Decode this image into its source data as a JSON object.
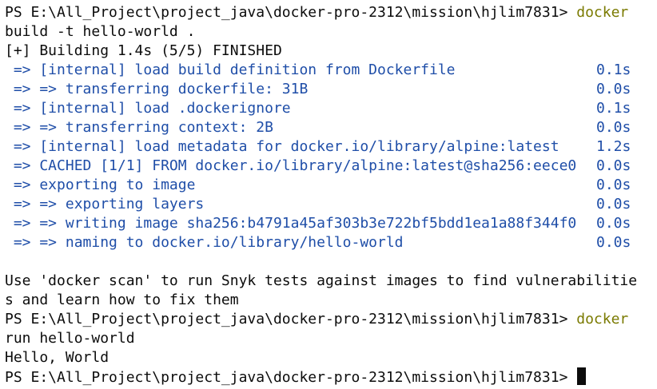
{
  "prompt": "PS E:\\All_Project\\project_java\\docker-pro-2312\\mission\\hjlim7831> ",
  "cmd1": {
    "first": "docker",
    "second": "build -t hello-world ."
  },
  "build_status": "[+] Building 1.4s (5/5) FINISHED",
  "build_steps": [
    {
      "desc": " => [internal] load build definition from Dockerfile",
      "time": "0.1s"
    },
    {
      "desc": " => => transferring dockerfile: 31B",
      "time": "0.0s"
    },
    {
      "desc": " => [internal] load .dockerignore",
      "time": "0.1s"
    },
    {
      "desc": " => => transferring context: 2B",
      "time": "0.0s"
    },
    {
      "desc": " => [internal] load metadata for docker.io/library/alpine:latest",
      "time": "1.2s"
    },
    {
      "desc": " => CACHED [1/1] FROM docker.io/library/alpine:latest@sha256:eece0",
      "time": "0.0s"
    },
    {
      "desc": " => exporting to image",
      "time": "0.0s"
    },
    {
      "desc": " => => exporting layers",
      "time": "0.0s"
    },
    {
      "desc": " => => writing image sha256:b4791a45af303b3e722bf5bdd1ea1a88f344f0",
      "time": "0.0s"
    },
    {
      "desc": " => => naming to docker.io/library/hello-world",
      "time": "0.0s"
    }
  ],
  "scan_hint": {
    "line1": "Use 'docker scan' to run Snyk tests against images to find vulnerabilitie",
    "line2": "s and learn how to fix them"
  },
  "cmd2": {
    "first": "docker",
    "second": "run hello-world"
  },
  "output": "Hello, World",
  "colors": {
    "background": "#ffffff",
    "text": "#0c0c0c",
    "command": "#7a7a00",
    "build_step": "#1f4ea8"
  }
}
